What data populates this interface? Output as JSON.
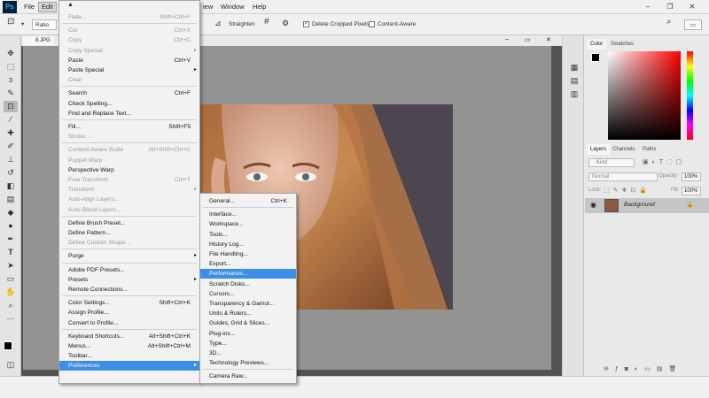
{
  "menubar": {
    "logo": "Ps",
    "items": [
      {
        "label": "File",
        "active": false
      },
      {
        "label": "Edit",
        "active": true
      },
      {
        "label": "iew",
        "active": false
      },
      {
        "label": "Window",
        "active": false
      },
      {
        "label": "Help",
        "active": false
      }
    ]
  },
  "options": {
    "ratio_label": "Ratio",
    "straighten_label": "Straighten",
    "delete_cropped_label": "Delete Cropped Pixels",
    "delete_cropped_checked": true,
    "content_aware_label": "Content-Aware",
    "content_aware_checked": false
  },
  "document": {
    "tab_label": "8.JPG"
  },
  "edit_menu": {
    "items": [
      {
        "label": "Fade...",
        "shortcut": "Shift+Ctrl+F",
        "disabled": true
      },
      {
        "sep": true
      },
      {
        "label": "Cut",
        "shortcut": "Ctrl+X",
        "disabled": true
      },
      {
        "label": "Copy",
        "shortcut": "Ctrl+C",
        "disabled": true
      },
      {
        "label": "Copy Special",
        "submenu": true,
        "disabled": true
      },
      {
        "label": "Paste",
        "shortcut": "Ctrl+V"
      },
      {
        "label": "Paste Special",
        "submenu": true
      },
      {
        "label": "Clear",
        "disabled": true
      },
      {
        "sep": true
      },
      {
        "label": "Search",
        "shortcut": "Ctrl+F"
      },
      {
        "label": "Check Spelling..."
      },
      {
        "label": "Find and Replace Text..."
      },
      {
        "sep": true
      },
      {
        "label": "Fill...",
        "shortcut": "Shift+F5"
      },
      {
        "label": "Stroke...",
        "disabled": true
      },
      {
        "sep": true
      },
      {
        "label": "Content-Aware Scale",
        "shortcut": "Alt+Shift+Ctrl+C",
        "disabled": true
      },
      {
        "label": "Puppet Warp",
        "disabled": true
      },
      {
        "label": "Perspective Warp"
      },
      {
        "label": "Free Transform",
        "shortcut": "Ctrl+T",
        "disabled": true
      },
      {
        "label": "Transform",
        "submenu": true,
        "disabled": true
      },
      {
        "label": "Auto-Align Layers...",
        "disabled": true
      },
      {
        "label": "Auto-Blend Layers...",
        "disabled": true
      },
      {
        "sep": true
      },
      {
        "label": "Define Brush Preset..."
      },
      {
        "label": "Define Pattern..."
      },
      {
        "label": "Define Custom Shape...",
        "disabled": true
      },
      {
        "sep": true
      },
      {
        "label": "Purge",
        "submenu": true
      },
      {
        "sep": true
      },
      {
        "label": "Adobe PDF Presets..."
      },
      {
        "label": "Presets",
        "submenu": true
      },
      {
        "label": "Remote Connections..."
      },
      {
        "sep": true
      },
      {
        "label": "Color Settings...",
        "shortcut": "Shift+Ctrl+K"
      },
      {
        "label": "Assign Profile..."
      },
      {
        "label": "Convert to Profile..."
      },
      {
        "sep": true
      },
      {
        "label": "Keyboard Shortcuts...",
        "shortcut": "Alt+Shift+Ctrl+K"
      },
      {
        "label": "Menus...",
        "shortcut": "Alt+Shift+Ctrl+M"
      },
      {
        "label": "Toolbar..."
      },
      {
        "label": "Preferences",
        "submenu": true,
        "highlighted": true
      }
    ]
  },
  "preferences_menu": {
    "items": [
      {
        "label": "General...",
        "shortcut": "Ctrl+K"
      },
      {
        "sep": true
      },
      {
        "label": "Interface..."
      },
      {
        "label": "Workspace..."
      },
      {
        "label": "Tools..."
      },
      {
        "label": "History Log..."
      },
      {
        "label": "File Handling..."
      },
      {
        "label": "Export..."
      },
      {
        "label": "Performance...",
        "highlighted": true
      },
      {
        "label": "Scratch Disks..."
      },
      {
        "label": "Cursors..."
      },
      {
        "label": "Transparency & Gamut..."
      },
      {
        "label": "Units & Rulers..."
      },
      {
        "label": "Guides, Grid & Slices..."
      },
      {
        "label": "Plug-ins..."
      },
      {
        "label": "Type..."
      },
      {
        "label": "3D..."
      },
      {
        "label": "Technology Previews..."
      },
      {
        "sep": true
      },
      {
        "label": "Camera Raw..."
      }
    ]
  },
  "color_panel": {
    "tabs": [
      "Color",
      "Swatches"
    ],
    "active_tab": "Color",
    "base_hue": "#ff0000"
  },
  "layers_panel": {
    "tabs": [
      "Layers",
      "Channels",
      "Paths"
    ],
    "filter_label": "Kind",
    "blend_mode": "Normal",
    "opacity_label": "Opacity:",
    "opacity_value": "100%",
    "lock_label": "Lock:",
    "fill_label": "Fill:",
    "fill_value": "100%",
    "layers": [
      {
        "name": "Background",
        "visible": true,
        "locked": true
      }
    ],
    "footer_icons": [
      "link-icon",
      "fx-icon",
      "mask-icon",
      "adjustment-icon",
      "folder-icon",
      "new-layer-icon",
      "trash-icon"
    ]
  },
  "tools": [
    "move-icon",
    "marquee-icon",
    "lasso-icon",
    "quick-select-icon",
    "crop-icon",
    "eyedropper-icon",
    "healing-icon",
    "brush-icon",
    "stamp-icon",
    "history-brush-icon",
    "eraser-icon",
    "gradient-icon",
    "blur-icon",
    "dodge-icon",
    "pen-icon",
    "type-icon",
    "path-select-icon",
    "rectangle-icon",
    "hand-icon",
    "zoom-icon",
    "more-icon"
  ]
}
